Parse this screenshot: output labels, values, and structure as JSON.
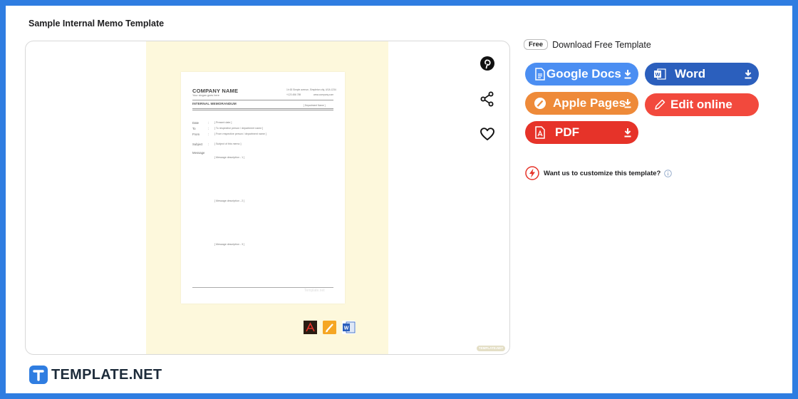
{
  "page": {
    "title": "Sample Internal Memo Template"
  },
  "preview": {
    "document": {
      "company_name": "COMPANY NAME",
      "tagline": "Your slogan goes here",
      "address": "1h 63 Simple avenue, Simpleton city, USA 1234",
      "phone": "+123 456 789",
      "website": "www.company.com",
      "memo_heading": "INTERNAL MEMORANDUM",
      "department": "[ Department Name ]",
      "fields": [
        {
          "label": "Date",
          "value": "[ Present date ]"
        },
        {
          "label": "To",
          "value": "[ To respective person / department name ]"
        },
        {
          "label": "From",
          "value": "[ From respective person / department name ]"
        },
        {
          "label": "Subject",
          "value": "[ Subject of this memo ]"
        },
        {
          "label": "Message",
          "value": ""
        }
      ],
      "messages": [
        "[ Message description - 1 ]",
        "[ Message description - 2 ]",
        "[ Message description - 3 ]"
      ],
      "watermark": "Template.net"
    },
    "formats": [
      "pdf-icon",
      "apple-pages-icon",
      "word-icon"
    ],
    "badge": "TEMPLATE.NET"
  },
  "actions": {
    "pinterest": "pinterest-icon",
    "share": "share-icon",
    "favorite": "heart-icon"
  },
  "download": {
    "free_tag": "Free",
    "heading": "Download Free Template",
    "buttons": {
      "google_docs": "Google Docs",
      "word": "Word",
      "apple_pages": "Apple Pages",
      "edit_online": "Edit online",
      "pdf": "PDF"
    }
  },
  "customize": {
    "text": "Want us to customize this template?"
  },
  "brand": {
    "name": "TEMPLATE.NET"
  },
  "colors": {
    "frame": "#2f7de1",
    "google_docs": "#4b8ef2",
    "word": "#2b5fbd",
    "apple_pages": "#ee8a39",
    "edit_online": "#f2493d",
    "pdf": "#e63329",
    "preview_bg": "#fdf8dc"
  }
}
